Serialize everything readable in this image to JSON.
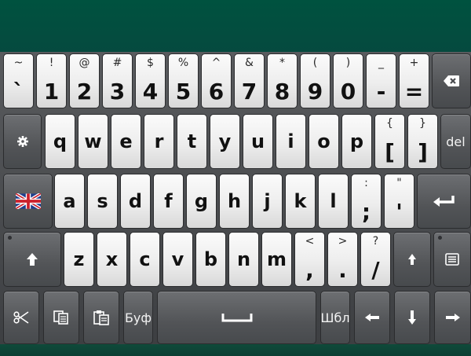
{
  "keyboard": {
    "row1": [
      {
        "upper": "~",
        "lower": "`"
      },
      {
        "upper": "!",
        "lower": "1"
      },
      {
        "upper": "@",
        "lower": "2"
      },
      {
        "upper": "#",
        "lower": "3"
      },
      {
        "upper": "$",
        "lower": "4"
      },
      {
        "upper": "%",
        "lower": "5"
      },
      {
        "upper": "^",
        "lower": "6"
      },
      {
        "upper": "&",
        "lower": "7"
      },
      {
        "upper": "*",
        "lower": "8"
      },
      {
        "upper": "(",
        "lower": "9"
      },
      {
        "upper": ")",
        "lower": "0"
      },
      {
        "upper": "_",
        "lower": "-"
      },
      {
        "upper": "+",
        "lower": "="
      }
    ],
    "row2": [
      "q",
      "w",
      "e",
      "r",
      "t",
      "y",
      "u",
      "i",
      "o",
      "p"
    ],
    "row2_extra": [
      {
        "upper": "{",
        "lower": "["
      },
      {
        "upper": "}",
        "lower": "]"
      }
    ],
    "row3": [
      "a",
      "s",
      "d",
      "f",
      "g",
      "h",
      "j",
      "k",
      "l"
    ],
    "row3_extra": [
      {
        "upper": ":",
        "lower": ";"
      },
      {
        "upper": "\"",
        "lower": "'"
      }
    ],
    "row4": [
      "z",
      "x",
      "c",
      "v",
      "b",
      "n",
      "m"
    ],
    "row4_extra": [
      {
        "upper": "<",
        "lower": ","
      },
      {
        "upper": ">",
        "lower": "."
      },
      {
        "upper": "?",
        "lower": "/"
      }
    ],
    "del_label": "del",
    "buf_label": "Буф",
    "template_label": "Шбл",
    "language": "English (UK)",
    "icons": {
      "backspace": "backspace-icon",
      "settings": "gear-icon",
      "enter": "enter-icon",
      "shift": "shift-up-icon",
      "menu": "menu-icon",
      "cut": "scissors-icon",
      "copy": "copy-icon",
      "paste": "paste-icon",
      "space": "space-icon",
      "left": "arrow-left-icon",
      "down": "arrow-down-icon",
      "right": "arrow-right-icon"
    },
    "colors": {
      "top_band": "#00523f",
      "light_key": "#f0f0f0",
      "dark_key": "#55575a",
      "frame": "#3d3f42"
    }
  }
}
